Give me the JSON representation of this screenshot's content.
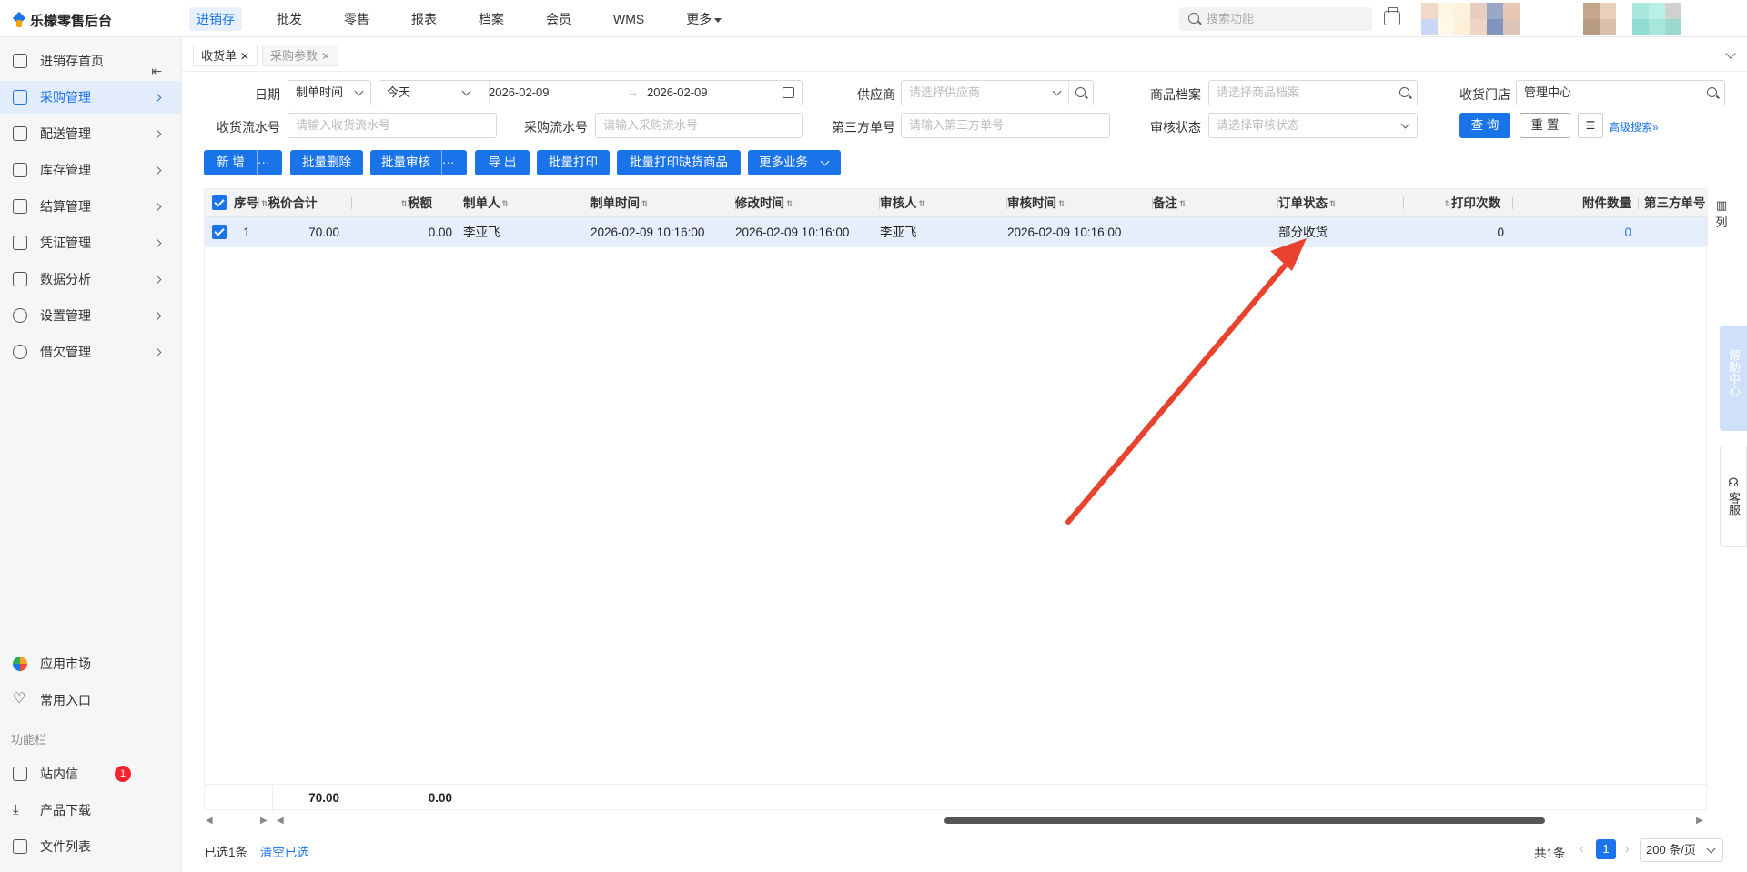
{
  "app": {
    "title": "乐檬零售后台"
  },
  "nav": {
    "items": [
      "进销存",
      "批发",
      "零售",
      "报表",
      "档案",
      "会员",
      "WMS",
      "更多"
    ],
    "active": "进销存"
  },
  "search": {
    "placeholder": "搜索功能"
  },
  "sidebar": {
    "items": [
      {
        "label": "进销存首页",
        "icon": "home-icon"
      },
      {
        "label": "采购管理",
        "icon": "cart-icon"
      },
      {
        "label": "配送管理",
        "icon": "delivery-icon"
      },
      {
        "label": "库存管理",
        "icon": "inventory-icon"
      },
      {
        "label": "结算管理",
        "icon": "settlement-icon"
      },
      {
        "label": "凭证管理",
        "icon": "voucher-icon"
      },
      {
        "label": "数据分析",
        "icon": "chart-icon"
      },
      {
        "label": "设置管理",
        "icon": "settings-icon"
      },
      {
        "label": "借欠管理",
        "icon": "debt-icon"
      }
    ],
    "active": "采购管理",
    "bottom": [
      {
        "label": "应用市场",
        "icon": "app-market-icon"
      },
      {
        "label": "常用入口",
        "icon": "heart-icon"
      }
    ],
    "section_label": "功能栏",
    "func": [
      {
        "label": "站内信",
        "icon": "mail-icon",
        "badge": "1"
      },
      {
        "label": "产品下载",
        "icon": "download-icon"
      },
      {
        "label": "文件列表",
        "icon": "file-list-icon"
      }
    ]
  },
  "tabs": [
    {
      "label": "收货单",
      "active": true
    },
    {
      "label": "采购参数",
      "active": false
    }
  ],
  "filters": {
    "date_label": "日期",
    "date_type": "制单时间",
    "date_range": "今天",
    "date_start": "2026-02-09",
    "date_sep": "→",
    "date_end": "2026-02-09",
    "supplier_label": "供应商",
    "supplier_ph": "请选择供应商",
    "goods_label": "商品档案",
    "goods_ph": "请选择商品档案",
    "store_label": "收货门店",
    "store_value": "管理中心",
    "recv_no_label": "收货流水号",
    "recv_no_ph": "请输入收货流水号",
    "purchase_no_label": "采购流水号",
    "purchase_no_ph": "请输入采购流水号",
    "third_no_label": "第三方单号",
    "third_no_ph": "请输入第三方单号",
    "audit_label": "审核状态",
    "audit_ph": "请选择审核状态",
    "query_btn": "查 询",
    "reset_btn": "重 置",
    "advanced": "高级搜索"
  },
  "toolbar": {
    "add": "新 增",
    "batch_delete": "批量删除",
    "batch_audit": "批量审核",
    "export": "导 出",
    "batch_print": "批量打印",
    "batch_print_missing": "批量打印缺货商品",
    "more_business": "更多业务",
    "more_dots": "···"
  },
  "table": {
    "headers": [
      "序号",
      "税价合计",
      "税额",
      "制单人",
      "制单时间",
      "修改时间",
      "审核人",
      "审核时间",
      "备注",
      "订单状态",
      "打印次数",
      "附件数量",
      "第三方单号"
    ],
    "col_setting": "列",
    "rows": [
      {
        "seq": "1",
        "total": "70.00",
        "tax": "0.00",
        "creator": "李亚飞",
        "created": "2026-02-09 10:16:00",
        "modified": "2026-02-09 10:16:00",
        "auditor": "李亚飞",
        "audited": "2026-02-09 10:16:00",
        "remark": "",
        "status": "部分收货",
        "print_count": "0",
        "attachments": "0",
        "third_no": ""
      }
    ],
    "footer": {
      "total": "70.00",
      "tax": "0.00"
    }
  },
  "bottom": {
    "selected": "已选1条",
    "clear": "清空已选",
    "total": "共1条",
    "page": "1",
    "page_size": "200 条/页"
  },
  "side_widgets": {
    "help": "帮助中心",
    "service": "客服"
  },
  "colors": {
    "accent": "#1a73e8",
    "annotation_arrow": "#e8432f"
  }
}
